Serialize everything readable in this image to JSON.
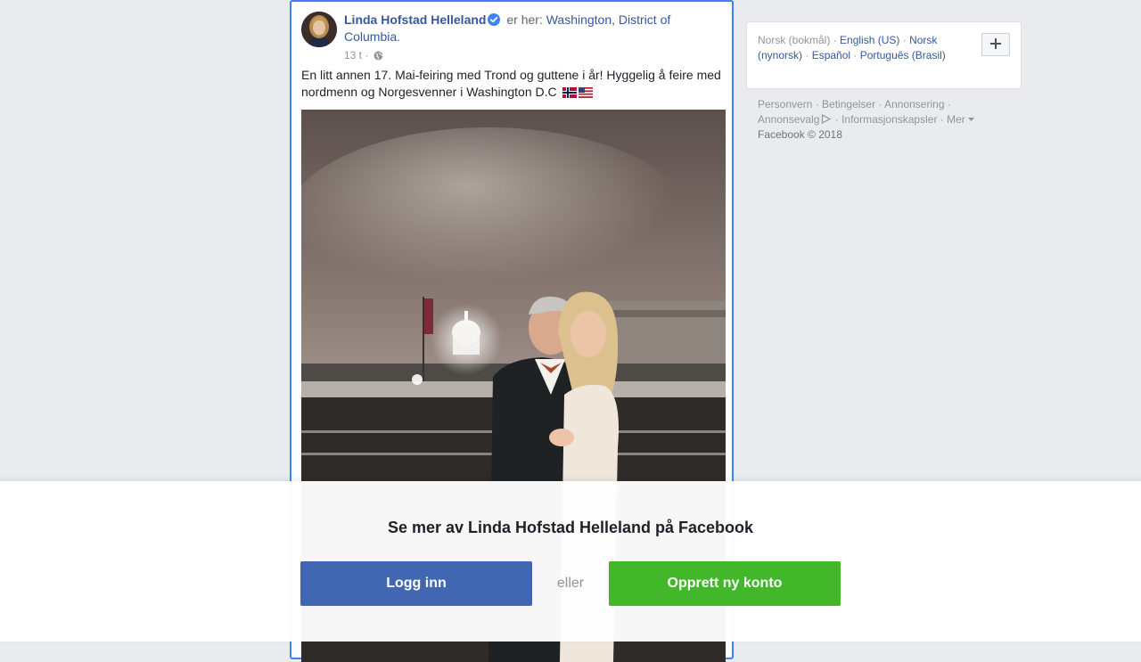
{
  "post": {
    "author": "Linda Hofstad Helleland",
    "location_prefix": "er her:",
    "location": "Washington, District of Columbia",
    "location_suffix": ".",
    "timestamp": "13 t",
    "separator": "·",
    "text": "En litt annen 17. Mai-feiring med Trond og guttene i år! Hyggelig å feire med nordmenn og Norgesvenner i Washington D.C",
    "flags": [
      "norway-flag",
      "usa-flag"
    ]
  },
  "languages": {
    "current": "Norsk (bokmål)",
    "items": [
      "English (US)",
      "Norsk (nynorsk)",
      "Español",
      "Português (Brasil)"
    ],
    "more_icon": "plus-icon"
  },
  "footer": {
    "links": [
      "Personvern",
      "Betingelser",
      "Annonsering",
      "Annonsevalg",
      "Informasjonskapsler",
      "Mer"
    ],
    "copyright": "Facebook © 2018"
  },
  "login_prompt": {
    "title": "Se mer av Linda Hofstad Helleland på Facebook",
    "login_label": "Logg inn",
    "or_label": "eller",
    "signup_label": "Opprett ny konto"
  },
  "colors": {
    "link": "#365899",
    "login_button": "#4267b2",
    "signup_button": "#42b72a",
    "page_bg": "#e9ebee"
  }
}
